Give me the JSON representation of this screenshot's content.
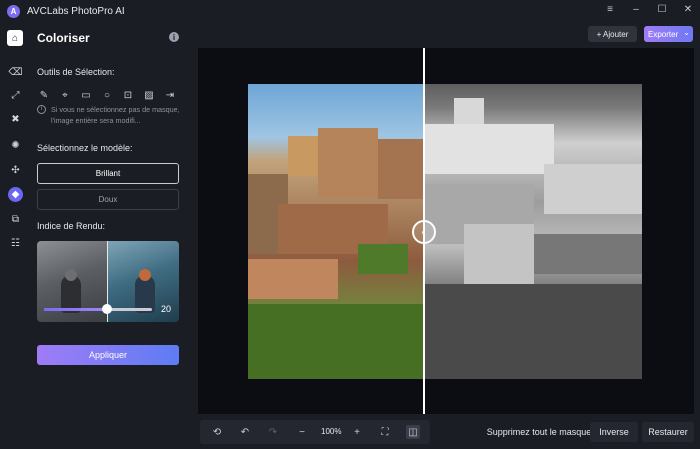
{
  "window": {
    "app_title": "AVCLabs PhotoPro AI",
    "logo_letter": "A",
    "controls": [
      "≡",
      "–",
      "☐",
      "✕"
    ]
  },
  "rail": {
    "items": [
      {
        "name": "home-icon",
        "glyph": "⌂"
      },
      {
        "name": "eraser-icon",
        "glyph": "⌫"
      },
      {
        "name": "upscale-icon",
        "glyph": "⤢"
      },
      {
        "name": "enhance-icon",
        "glyph": "✖"
      },
      {
        "name": "portrait-icon",
        "glyph": "✺"
      },
      {
        "name": "remove-bg-icon",
        "glyph": "✣"
      },
      {
        "name": "colorize-icon",
        "glyph": "◆"
      },
      {
        "name": "replace-icon",
        "glyph": "⧉"
      },
      {
        "name": "adjust-icon",
        "glyph": "☷"
      }
    ]
  },
  "panel": {
    "title": "Coloriser",
    "info_glyph": "i",
    "selection_tools_label": "Outils de Sélection:",
    "tools": [
      {
        "name": "brush-tool-icon",
        "glyph": "✎"
      },
      {
        "name": "lasso-tool-icon",
        "glyph": "⌖"
      },
      {
        "name": "rectangle-tool-icon",
        "glyph": "▭"
      },
      {
        "name": "ellipse-tool-icon",
        "glyph": "○"
      },
      {
        "name": "portrait-select-icon",
        "glyph": "⊡"
      },
      {
        "name": "invert-select-icon",
        "glyph": "▨"
      },
      {
        "name": "import-mask-icon",
        "glyph": "⇥"
      }
    ],
    "hint_icon": "i",
    "hint": "Si vous ne sélectionnez pas de masque, l'image entière sera modifi...",
    "model_label": "Sélectionnez le modèle:",
    "model_options": [
      "Brillant",
      "Doux"
    ],
    "render_label": "Indice de Rendu:",
    "render_value": "20",
    "render_fraction": 0.58,
    "apply_label": "Appliquer"
  },
  "actions": {
    "add_label": "+ Ajouter",
    "export_label": "Exporter",
    "export_chevron": "⌄"
  },
  "compare_handle_glyph": "◐",
  "bottom": {
    "zoom": "100%",
    "glyphs": {
      "reset": "⟲",
      "undo": "↶",
      "redo": "↷",
      "zoom_out": "−",
      "zoom_in": "+",
      "fit": "⛶",
      "compare": "◫"
    },
    "mask_label": "Supprimez tout le masque",
    "inverse_label": "Inverse",
    "restore_label": "Restaurer"
  }
}
